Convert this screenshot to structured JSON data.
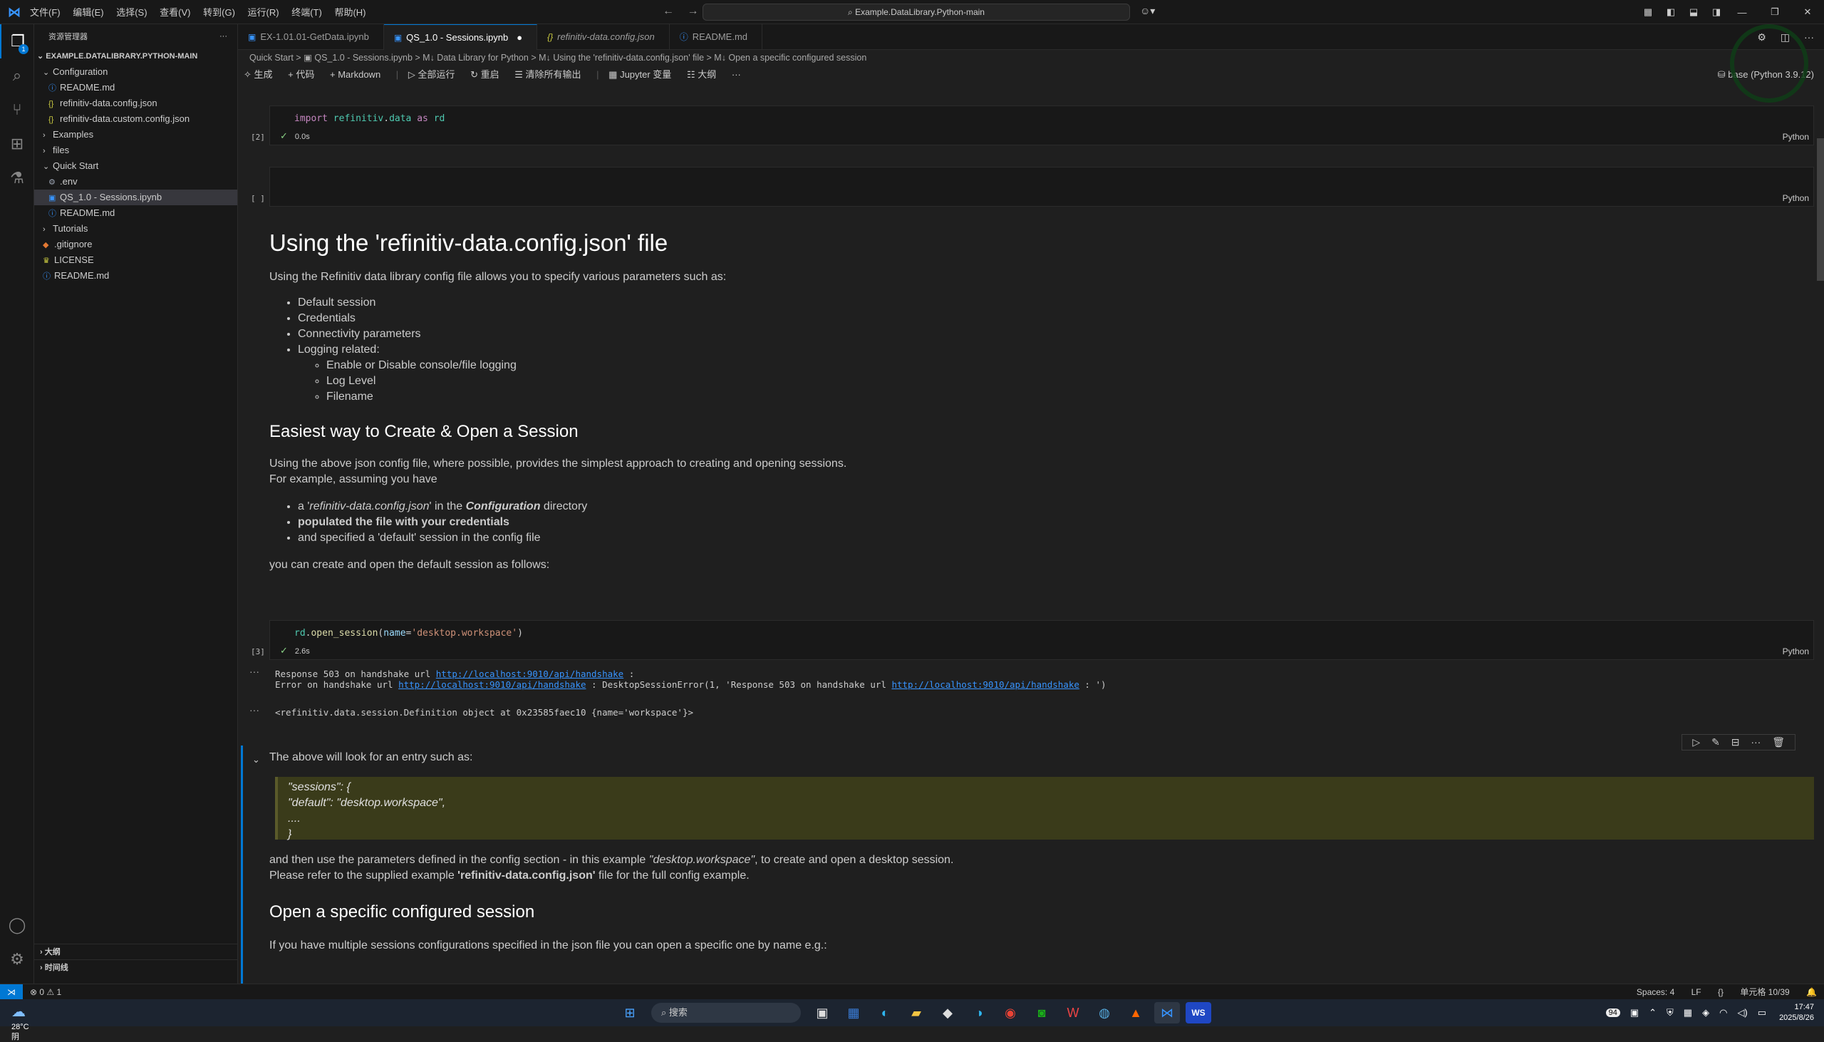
{
  "titlebar": {
    "menu": [
      "文件(F)",
      "编辑(E)",
      "选择(S)",
      "查看(V)",
      "转到(G)",
      "运行(R)",
      "终端(T)",
      "帮助(H)"
    ],
    "search": "Example.DataLibrary.Python-main"
  },
  "explorer": {
    "title": "资源管理器",
    "root": "EXAMPLE.DATALIBRARY.PYTHON-MAIN",
    "items": [
      {
        "label": "Configuration",
        "type": "folder-open",
        "depth": 0
      },
      {
        "label": "README.md",
        "type": "info",
        "depth": 1
      },
      {
        "label": "refinitiv-data.config.json",
        "type": "json",
        "depth": 1
      },
      {
        "label": "refinitiv-data.custom.config.json",
        "type": "json",
        "depth": 1
      },
      {
        "label": "Examples",
        "type": "folder",
        "depth": 0
      },
      {
        "label": "files",
        "type": "folder",
        "depth": 0
      },
      {
        "label": "Quick Start",
        "type": "folder-open",
        "depth": 0
      },
      {
        "label": ".env",
        "type": "gear",
        "depth": 1
      },
      {
        "label": "QS_1.0 - Sessions.ipynb",
        "type": "nb",
        "depth": 1,
        "selected": true
      },
      {
        "label": "README.md",
        "type": "info",
        "depth": 1
      },
      {
        "label": "Tutorials",
        "type": "folder",
        "depth": 0
      },
      {
        "label": ".gitignore",
        "type": "git",
        "depth": 0
      },
      {
        "label": "LICENSE",
        "type": "lic",
        "depth": 0
      },
      {
        "label": "README.md",
        "type": "info",
        "depth": 0
      }
    ],
    "outline": "大纲",
    "timeline": "时间线"
  },
  "tabs": [
    {
      "label": "EX-1.01.01-GetData.ipynb",
      "active": false
    },
    {
      "label": "QS_1.0 - Sessions.ipynb",
      "active": true
    },
    {
      "label": "refinitiv-data.config.json",
      "active": false,
      "italic": true
    },
    {
      "label": "README.md",
      "active": false
    }
  ],
  "breadcrumb": "Quick Start  >  ▣ QS_1.0 - Sessions.ipynb  >  M↓ Data Library for Python  >  M↓ Using the 'refinitiv-data.config.json' file  >  M↓ Open a specific configured session",
  "toolbar": {
    "generate": "生成",
    "code": "+ 代码",
    "markdown": "+ Markdown",
    "run_all": "全部运行",
    "restart": "重启",
    "clear": "清除所有输出",
    "variables": "Jupyter 变量",
    "outline": "大纲",
    "kernel": "base (Python 3.9.12)"
  },
  "cells": {
    "c1": {
      "count": "[2]",
      "time": "0.0s",
      "lang": "Python"
    },
    "c2": {
      "count": "[ ]",
      "lang": "Python"
    },
    "c3": {
      "count": "[3]",
      "time": "2.6s",
      "lang": "Python"
    }
  },
  "md1": {
    "h1": "Using the 'refinitiv-data.config.json' file",
    "p1": "Using the Refinitiv data library config file allows you to specify various parameters such as:",
    "li": [
      "Default session",
      "Credentials",
      "Connectivity parameters",
      "Logging related:"
    ],
    "sub": [
      "Enable or Disable console/file logging",
      "Log Level",
      "Filename"
    ],
    "h2": "Easiest way to Create & Open a Session",
    "p2a": "Using the above json config file, where possible, provides the simplest approach to creating and opening sessions.",
    "p2b": "For example, assuming you have",
    "b1a": "a '",
    "b1b": "refinitiv-data.config.json",
    "b1c": "' in the ",
    "b1d": "Configuration",
    "b1e": " directory",
    "b2": "populated the file with your credentials",
    "b3": "and specified a 'default' session in the config file",
    "p3": "you can create and open the default session as follows:"
  },
  "output": {
    "l1a": "Response 503 on handshake url ",
    "link": "http://localhost:9010/api/handshake",
    "l1b": " :",
    "l2a": "Error on handshake url ",
    "l2b": " : DesktopSessionError(1, 'Response 503 on handshake url ",
    "l2c": " : ')",
    "l3": "<refinitiv.data.session.Definition object at 0x23585faec10 {name='workspace'}>"
  },
  "md2": {
    "p1": "The above will look for an entry such as:",
    "q": [
      "\"sessions\": {",
      "\"default\": \"desktop.workspace\",",
      "....",
      "}"
    ],
    "p2a": "and then use the parameters defined in the config section - in this example ",
    "p2b": "\"desktop.workspace\"",
    "p2c": ", to create and open a desktop session.",
    "p3a": "Please refer to the supplied example ",
    "p3b": "'refinitiv-data.config.json'",
    "p3c": " file for the full config example.",
    "h2": "Open a specific configured session",
    "p4": "If you have multiple sessions configurations specified in the json file you can open a specific one by name e.g.:"
  },
  "status": {
    "problems": "⊗ 0 ⚠ 1",
    "spaces": "Spaces: 4",
    "eol": "LF",
    "cell": "单元格 10/39"
  },
  "taskbar": {
    "temp": "28°C",
    "cond": "阴",
    "search": "搜索",
    "tray_badge": "94",
    "time": "17:47",
    "date": "2025/8/26"
  },
  "colors": {
    "accent": "#0078d4",
    "bg": "#1f1f1f",
    "sidebar": "#181818"
  }
}
